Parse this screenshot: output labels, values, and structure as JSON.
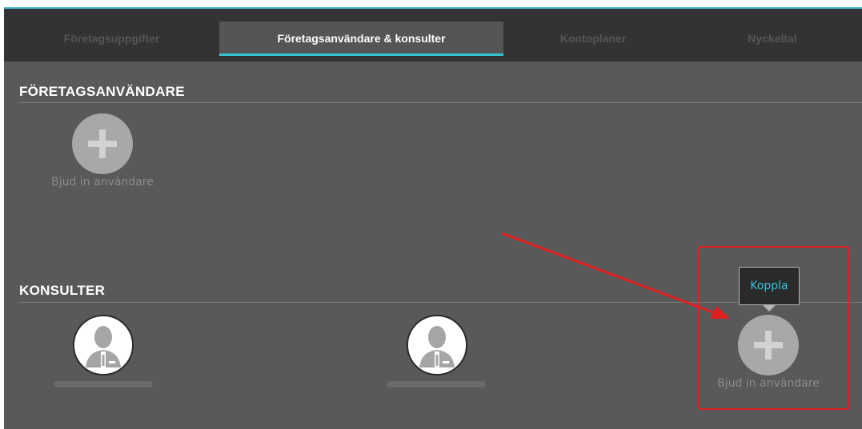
{
  "tabs": [
    {
      "label": "Företagsuppgifter",
      "active": false
    },
    {
      "label": "Företagsanvändare & konsulter",
      "active": true
    },
    {
      "label": "Kontoplaner",
      "active": false
    },
    {
      "label": "Nyckeltal",
      "active": false
    }
  ],
  "company_users": {
    "title": "FÖRETAGSANVÄNDARE",
    "invite_label": "Bjud in användare"
  },
  "consultants": {
    "title": "KONSULTER",
    "invite_label": "Bjud in användare"
  },
  "tooltip": {
    "text": "Koppla"
  },
  "colors": {
    "accent": "#35c3d6",
    "background": "#595959",
    "tabbar": "#333333",
    "annotation_red": "#e02020"
  },
  "icons": [
    "plus-icon",
    "user-avatar-icon"
  ]
}
